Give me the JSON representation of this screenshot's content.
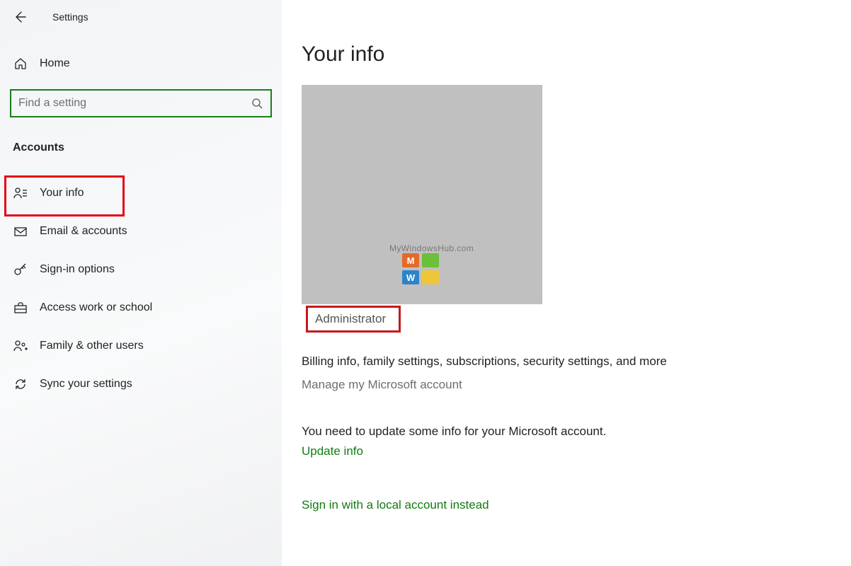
{
  "header": {
    "app_title": "Settings"
  },
  "sidebar": {
    "home_label": "Home",
    "search_placeholder": "Find a setting",
    "section_title": "Accounts",
    "items": [
      {
        "label": "Your info"
      },
      {
        "label": "Email & accounts"
      },
      {
        "label": "Sign-in options"
      },
      {
        "label": "Access work or school"
      },
      {
        "label": "Family & other users"
      },
      {
        "label": "Sync your settings"
      }
    ]
  },
  "main": {
    "page_title": "Your info",
    "watermark": "MyWindowsHub.com",
    "role": "Administrator",
    "billing_text": "Billing info, family settings, subscriptions, security settings, and more",
    "manage_link": "Manage my Microsoft account",
    "update_msg": "You need to update some info for your Microsoft account.",
    "update_link": "Update info",
    "local_account_link": "Sign in with a local account instead"
  }
}
